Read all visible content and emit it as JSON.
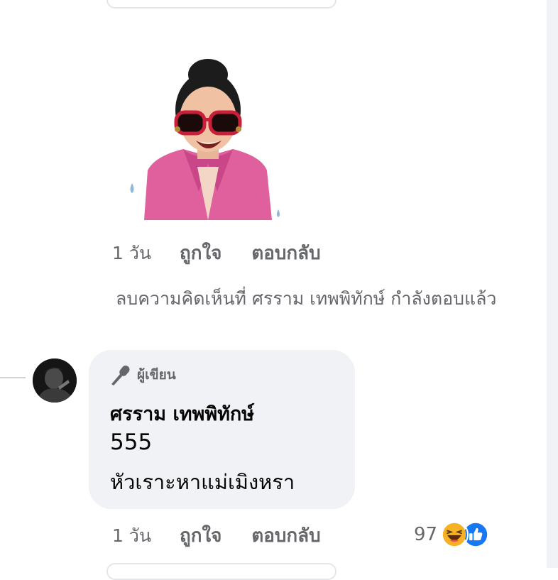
{
  "sticker": {
    "icon": "memoji-sticker-pink-jacket-sunglasses"
  },
  "comment1_meta": {
    "time": "1 วัน",
    "like": "ถูกใจ",
    "reply": "ตอบกลับ"
  },
  "deleted_note": "ลบความคิดเห็นที่ ศรราม เทพพิทักษ์ กำลังตอบแล้ว",
  "reply": {
    "badge": "ผู้เขียน",
    "badge_icon": "microphone-icon",
    "author": "ศรราม เทพพิทักษ์",
    "line1": "555",
    "line2": "หัวเราะหาแม่เมิงหรา"
  },
  "reply_meta": {
    "time": "1 วัน",
    "like": "ถูกใจ",
    "reply": "ตอบกลับ"
  },
  "reactions": {
    "count": "97",
    "icons": [
      "haha-icon",
      "like-icon"
    ]
  },
  "colors": {
    "bubble": "#f0f2f5",
    "meta": "#65676b",
    "like_blue": "#1877f2",
    "haha_yellow": "#f7b125"
  }
}
